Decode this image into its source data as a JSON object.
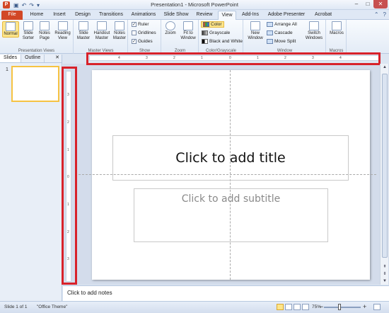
{
  "window": {
    "title": "Presentation1 - Microsoft PowerPoint",
    "app_icon_letter": "P",
    "qat": [
      "save-icon",
      "undo-icon",
      "redo-icon",
      "customize-icon"
    ],
    "controls": {
      "minimize": "–",
      "maximize": "□",
      "close": "✕"
    }
  },
  "tabs": [
    "File",
    "Home",
    "Insert",
    "Design",
    "Transitions",
    "Animations",
    "Slide Show",
    "Review",
    "View",
    "Add-Ins",
    "Adobe Presenter",
    "Acrobat"
  ],
  "active_tab": "View",
  "ribbon": {
    "presentation_views": {
      "label": "Presentation Views",
      "buttons": [
        "Normal",
        "Slide Sorter",
        "Notes Page",
        "Reading View"
      ]
    },
    "master_views": {
      "label": "Master Views",
      "buttons": [
        "Slide Master",
        "Handout Master",
        "Notes Master"
      ]
    },
    "show": {
      "label": "Show",
      "checks": [
        {
          "label": "Ruler",
          "checked": true
        },
        {
          "label": "Gridlines",
          "checked": false
        },
        {
          "label": "Guides",
          "checked": true
        }
      ]
    },
    "zoom": {
      "label": "Zoom",
      "buttons": [
        "Zoom",
        "Fit to Window"
      ]
    },
    "color": {
      "label": "Color/Grayscale",
      "options": [
        "Color",
        "Grayscale",
        "Black and White"
      ],
      "selected": "Color"
    },
    "window": {
      "label": "Window",
      "new_window": "New Window",
      "items": [
        "Arrange All",
        "Cascade",
        "Move Split"
      ],
      "switch": "Switch Windows"
    },
    "macros": {
      "label": "Macros",
      "button": "Macros"
    }
  },
  "left_pane": {
    "tabs": [
      "Slides",
      "Outline"
    ],
    "active_tab": "Slides",
    "close": "✕",
    "slide_number": "1"
  },
  "ruler_h_labels": [
    "4",
    "3",
    "2",
    "1",
    "0",
    "1",
    "2",
    "3",
    "4"
  ],
  "ruler_v_labels": [
    "3",
    "2",
    "1",
    "0",
    "1",
    "2",
    "3"
  ],
  "slide": {
    "title_placeholder": "Click to add title",
    "subtitle_placeholder": "Click to add subtitle"
  },
  "notes": {
    "placeholder": "Click to add notes"
  },
  "status": {
    "slide": "Slide 1 of 1",
    "theme": "\"Office Theme\"",
    "zoom": "75%"
  },
  "colors": {
    "accent_file": "#d24726",
    "highlight": "#d8222a",
    "selection": "#fde58a"
  }
}
